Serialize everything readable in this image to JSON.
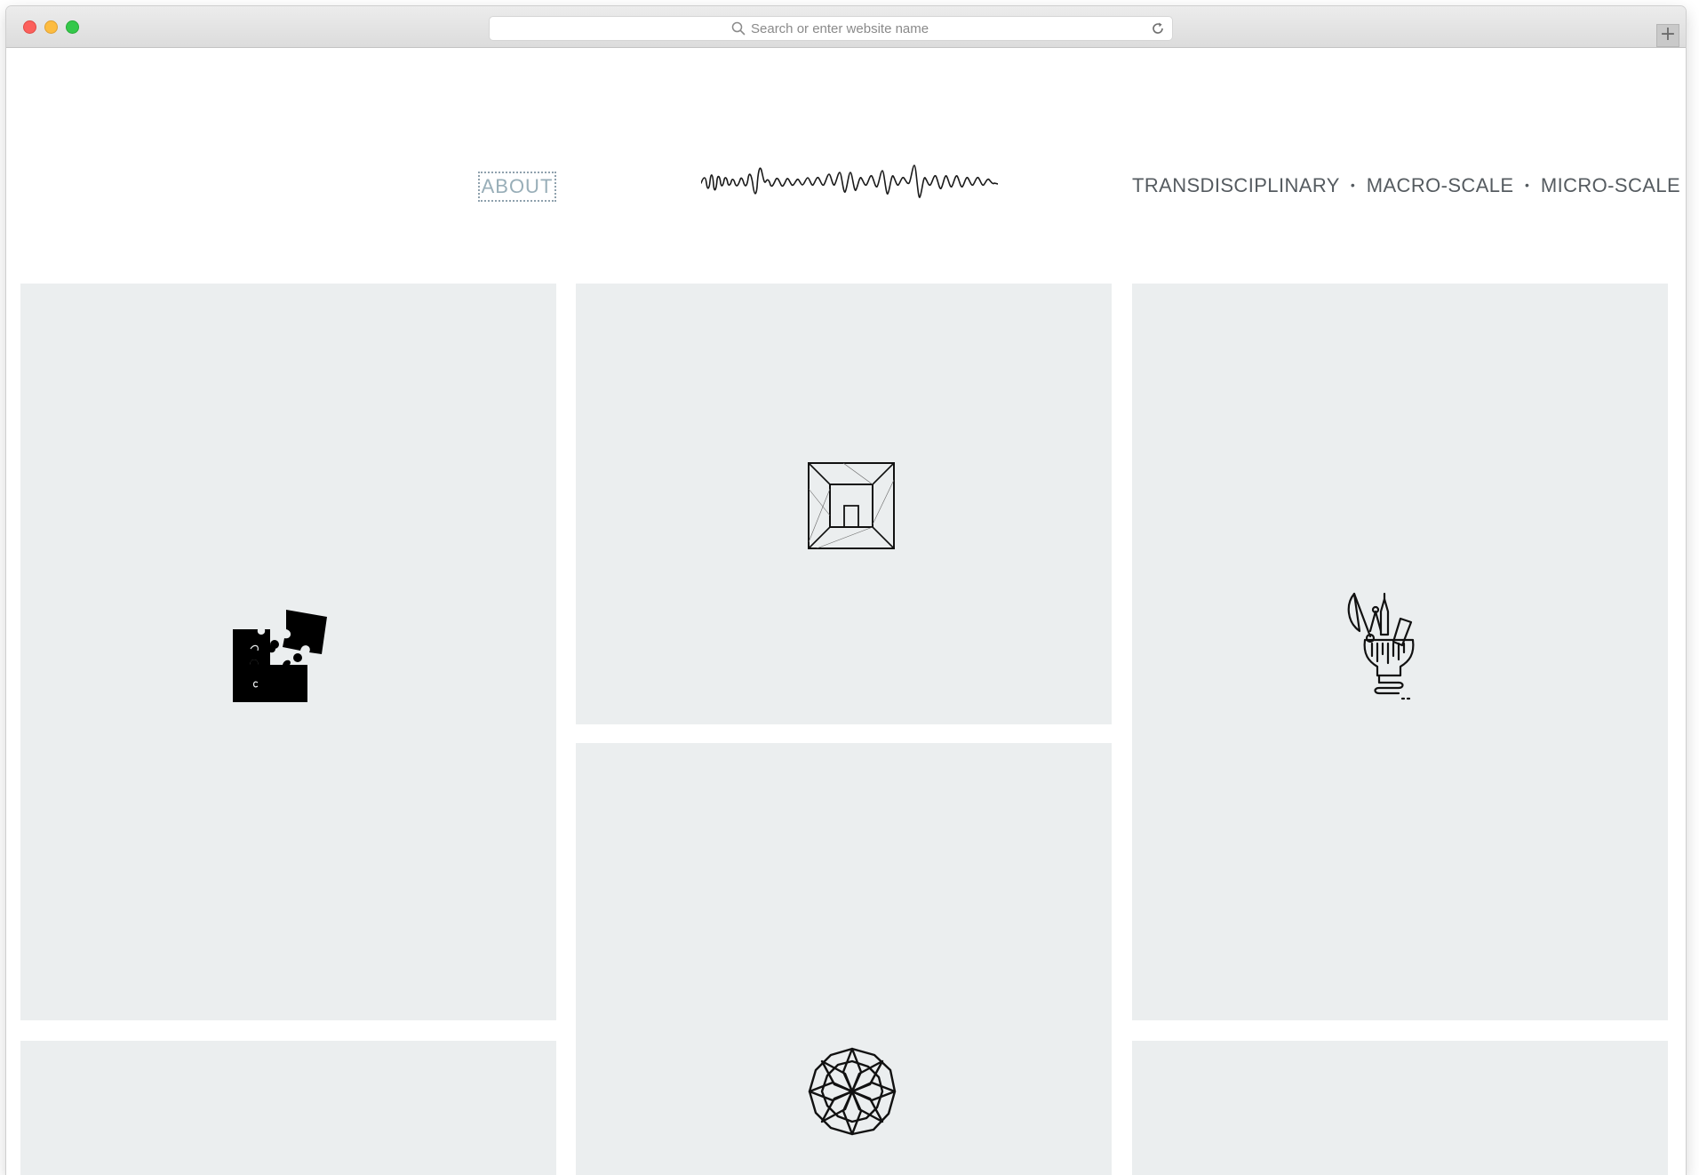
{
  "browser": {
    "url_placeholder": "Search or enter website name",
    "new_tab_label": "+"
  },
  "header": {
    "about_label": "ABOUT",
    "tagline_items": [
      "TRANSDISCIPLINARY",
      "MACRO-SCALE",
      "MICRO-SCALE"
    ],
    "tagline_separator": "•"
  },
  "tiles": [
    {
      "icon": "puzzle-pieces-icon"
    },
    {
      "icon": "box-room-perspective-icon"
    },
    {
      "icon": "lightbulb-tools-icon"
    },
    {
      "icon": "mandala-flower-icon"
    },
    {
      "icon": ""
    },
    {
      "icon": ""
    }
  ],
  "colors": {
    "tile_background": "#ebeeef",
    "about_link": "#98aeb8",
    "tagline": "#555b60"
  }
}
